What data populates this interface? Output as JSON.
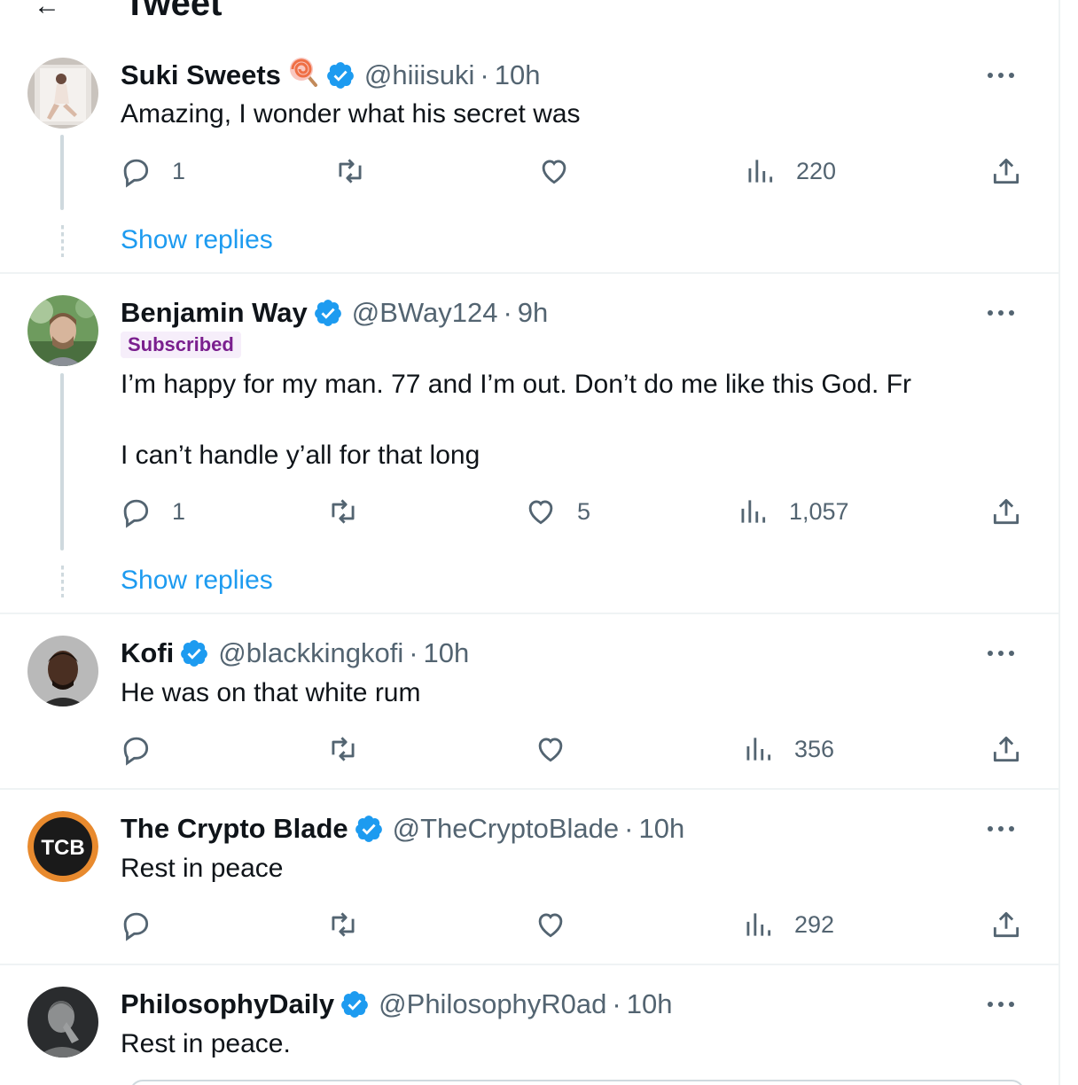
{
  "header": {
    "title": "Tweet"
  },
  "replies": [
    {
      "name": "Suki Sweets",
      "emoji": "🍭",
      "handle": "@hiiisuki",
      "time": "10h",
      "subscribed": "",
      "text": [
        "Amazing, I wonder what his secret was"
      ],
      "replies_count": "1",
      "retweets": "",
      "likes": "",
      "views": "220",
      "show_replies": "Show replies"
    },
    {
      "name": "Benjamin Way",
      "emoji": "",
      "handle": "@BWay124",
      "time": "9h",
      "subscribed": "Subscribed",
      "text": [
        "I’m happy for my man. 77 and I’m out. Don’t do me like this God. Fr",
        "I can’t handle y’all for that long"
      ],
      "replies_count": "1",
      "retweets": "",
      "likes": "5",
      "views": "1,057",
      "show_replies": "Show replies"
    },
    {
      "name": "Kofi",
      "emoji": "",
      "handle": "@blackkingkofi",
      "time": "10h",
      "subscribed": "",
      "text": [
        "He was on that white rum"
      ],
      "replies_count": "",
      "retweets": "",
      "likes": "",
      "views": "356",
      "show_replies": ""
    },
    {
      "name": "The Crypto Blade",
      "emoji": "",
      "handle": "@TheCryptoBlade",
      "time": "10h",
      "subscribed": "",
      "text": [
        "Rest in peace"
      ],
      "replies_count": "",
      "retweets": "",
      "likes": "",
      "views": "292",
      "show_replies": ""
    },
    {
      "name": "PhilosophyDaily",
      "emoji": "",
      "handle": "@PhilosophyR0ad",
      "time": "10h",
      "subscribed": "",
      "text": [
        "Rest in peace."
      ],
      "replies_count": "",
      "retweets": "",
      "likes": "",
      "views": "",
      "show_replies": ""
    }
  ],
  "avatars": {
    "crypto_blade_initials": "TCB"
  },
  "colors": {
    "verified": "#1d9bf0",
    "link": "#1d9bf0",
    "muted": "#536471",
    "subscribed_bg": "#f6eefa",
    "subscribed_fg": "#7a1f8e"
  },
  "icons": {
    "reply": "reply-icon",
    "retweet": "retweet-icon",
    "like": "heart-icon",
    "views": "views-icon",
    "share": "share-icon",
    "more": "more-icon",
    "verified": "verified-badge-icon"
  }
}
